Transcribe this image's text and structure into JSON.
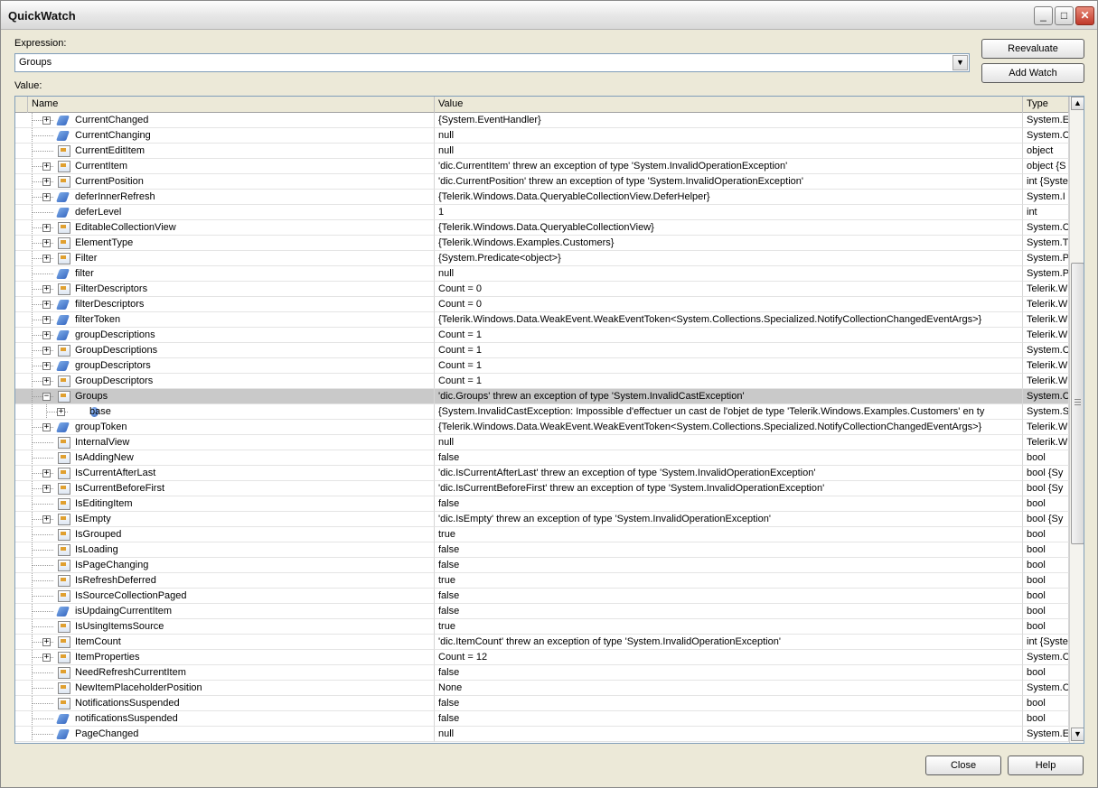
{
  "window": {
    "title": "QuickWatch",
    "minimize": "_",
    "maximize": "□",
    "close": "✕"
  },
  "expression": {
    "label": "Expression:",
    "value": "Groups",
    "dropdown_glyph": "▼"
  },
  "value_label": "Value:",
  "buttons": {
    "reevaluate": "Reevaluate",
    "add_watch": "Add Watch",
    "close": "Close",
    "help": "Help"
  },
  "columns": {
    "name": "Name",
    "value": "Value",
    "type": "Type"
  },
  "scroll": {
    "up": "▲",
    "down": "▼"
  },
  "rows": [
    {
      "name": "CurrentChanged",
      "value": "{System.EventHandler}",
      "type": "System.E",
      "icon": "field-icon",
      "exp": "+"
    },
    {
      "name": "CurrentChanging",
      "value": "null",
      "type": "System.C",
      "icon": "field-icon",
      "exp": ""
    },
    {
      "name": "CurrentEditItem",
      "value": "null",
      "type": "object",
      "icon": "property-icon",
      "exp": ""
    },
    {
      "name": "CurrentItem",
      "value": "'dic.CurrentItem' threw an exception of type 'System.InvalidOperationException'",
      "type": "object {S",
      "icon": "property-icon",
      "exp": "+"
    },
    {
      "name": "CurrentPosition",
      "value": "'dic.CurrentPosition' threw an exception of type 'System.InvalidOperationException'",
      "type": "int {Syste",
      "icon": "property-icon",
      "exp": "+"
    },
    {
      "name": "deferInnerRefresh",
      "value": "{Telerik.Windows.Data.QueryableCollectionView.DeferHelper}",
      "type": "System.I",
      "icon": "field-icon",
      "exp": "+"
    },
    {
      "name": "deferLevel",
      "value": "1",
      "type": "int",
      "icon": "field-icon",
      "exp": ""
    },
    {
      "name": "EditableCollectionView",
      "value": "{Telerik.Windows.Data.QueryableCollectionView}",
      "type": "System.C",
      "icon": "property-icon",
      "exp": "+"
    },
    {
      "name": "ElementType",
      "value": "{Telerik.Windows.Examples.Customers}",
      "type": "System.T",
      "icon": "property-icon",
      "exp": "+"
    },
    {
      "name": "Filter",
      "value": "{System.Predicate<object>}",
      "type": "System.P",
      "icon": "property-icon",
      "exp": "+"
    },
    {
      "name": "filter",
      "value": "null",
      "type": "System.P",
      "icon": "field-icon",
      "exp": ""
    },
    {
      "name": "FilterDescriptors",
      "value": "Count = 0",
      "type": "Telerik.W",
      "icon": "property-icon",
      "exp": "+"
    },
    {
      "name": "filterDescriptors",
      "value": "Count = 0",
      "type": "Telerik.W",
      "icon": "field-icon",
      "exp": "+"
    },
    {
      "name": "filterToken",
      "value": "{Telerik.Windows.Data.WeakEvent.WeakEventToken<System.Collections.Specialized.NotifyCollectionChangedEventArgs>}",
      "type": "Telerik.W",
      "icon": "field-icon",
      "exp": "+"
    },
    {
      "name": "groupDescriptions",
      "value": "Count = 1",
      "type": "Telerik.W",
      "icon": "field-icon",
      "exp": "+"
    },
    {
      "name": "GroupDescriptions",
      "value": "Count = 1",
      "type": "System.C",
      "icon": "property-icon",
      "exp": "+"
    },
    {
      "name": "groupDescriptors",
      "value": "Count = 1",
      "type": "Telerik.W",
      "icon": "field-icon",
      "exp": "+"
    },
    {
      "name": "GroupDescriptors",
      "value": "Count = 1",
      "type": "Telerik.W",
      "icon": "property-icon",
      "exp": "+"
    },
    {
      "name": "Groups",
      "value": "'dic.Groups' threw an exception of type 'System.InvalidCastException'",
      "type": "System.C",
      "icon": "property-icon",
      "exp": "−",
      "selected": true
    },
    {
      "name": "base",
      "value": "{System.InvalidCastException: Impossible d'effectuer un cast de l'objet de type 'Telerik.Windows.Examples.Customers' en ty",
      "type": "System.S",
      "icon": "base-icon",
      "exp": "+",
      "child": true
    },
    {
      "name": "groupToken",
      "value": "{Telerik.Windows.Data.WeakEvent.WeakEventToken<System.Collections.Specialized.NotifyCollectionChangedEventArgs>}",
      "type": "Telerik.W",
      "icon": "field-icon",
      "exp": "+"
    },
    {
      "name": "InternalView",
      "value": "null",
      "type": "Telerik.W",
      "icon": "property-icon",
      "exp": ""
    },
    {
      "name": "IsAddingNew",
      "value": "false",
      "type": "bool",
      "icon": "property-icon",
      "exp": ""
    },
    {
      "name": "IsCurrentAfterLast",
      "value": "'dic.IsCurrentAfterLast' threw an exception of type 'System.InvalidOperationException'",
      "type": "bool {Sy",
      "icon": "property-icon",
      "exp": "+"
    },
    {
      "name": "IsCurrentBeforeFirst",
      "value": "'dic.IsCurrentBeforeFirst' threw an exception of type 'System.InvalidOperationException'",
      "type": "bool {Sy",
      "icon": "property-icon",
      "exp": "+"
    },
    {
      "name": "IsEditingItem",
      "value": "false",
      "type": "bool",
      "icon": "property-icon",
      "exp": ""
    },
    {
      "name": "IsEmpty",
      "value": "'dic.IsEmpty' threw an exception of type 'System.InvalidOperationException'",
      "type": "bool {Sy",
      "icon": "property-icon",
      "exp": "+"
    },
    {
      "name": "IsGrouped",
      "value": "true",
      "type": "bool",
      "icon": "property-icon",
      "exp": ""
    },
    {
      "name": "IsLoading",
      "value": "false",
      "type": "bool",
      "icon": "property-icon",
      "exp": ""
    },
    {
      "name": "IsPageChanging",
      "value": "false",
      "type": "bool",
      "icon": "property-icon",
      "exp": ""
    },
    {
      "name": "IsRefreshDeferred",
      "value": "true",
      "type": "bool",
      "icon": "property-icon",
      "exp": ""
    },
    {
      "name": "IsSourceCollectionPaged",
      "value": "false",
      "type": "bool",
      "icon": "property-icon",
      "exp": ""
    },
    {
      "name": "isUpdaingCurrentItem",
      "value": "false",
      "type": "bool",
      "icon": "field-icon",
      "exp": ""
    },
    {
      "name": "IsUsingItemsSource",
      "value": "true",
      "type": "bool",
      "icon": "property-icon",
      "exp": ""
    },
    {
      "name": "ItemCount",
      "value": "'dic.ItemCount' threw an exception of type 'System.InvalidOperationException'",
      "type": "int {Syste",
      "icon": "property-icon",
      "exp": "+"
    },
    {
      "name": "ItemProperties",
      "value": "Count = 12",
      "type": "System.C",
      "icon": "property-icon",
      "exp": "+"
    },
    {
      "name": "NeedRefreshCurrentItem",
      "value": "false",
      "type": "bool",
      "icon": "property-icon",
      "exp": ""
    },
    {
      "name": "NewItemPlaceholderPosition",
      "value": "None",
      "type": "System.C",
      "icon": "property-icon",
      "exp": ""
    },
    {
      "name": "NotificationsSuspended",
      "value": "false",
      "type": "bool",
      "icon": "property-icon",
      "exp": ""
    },
    {
      "name": "notificationsSuspended",
      "value": "false",
      "type": "bool",
      "icon": "field-icon",
      "exp": ""
    },
    {
      "name": "PageChanged",
      "value": "null",
      "type": "System.E",
      "icon": "field-icon",
      "exp": ""
    }
  ]
}
